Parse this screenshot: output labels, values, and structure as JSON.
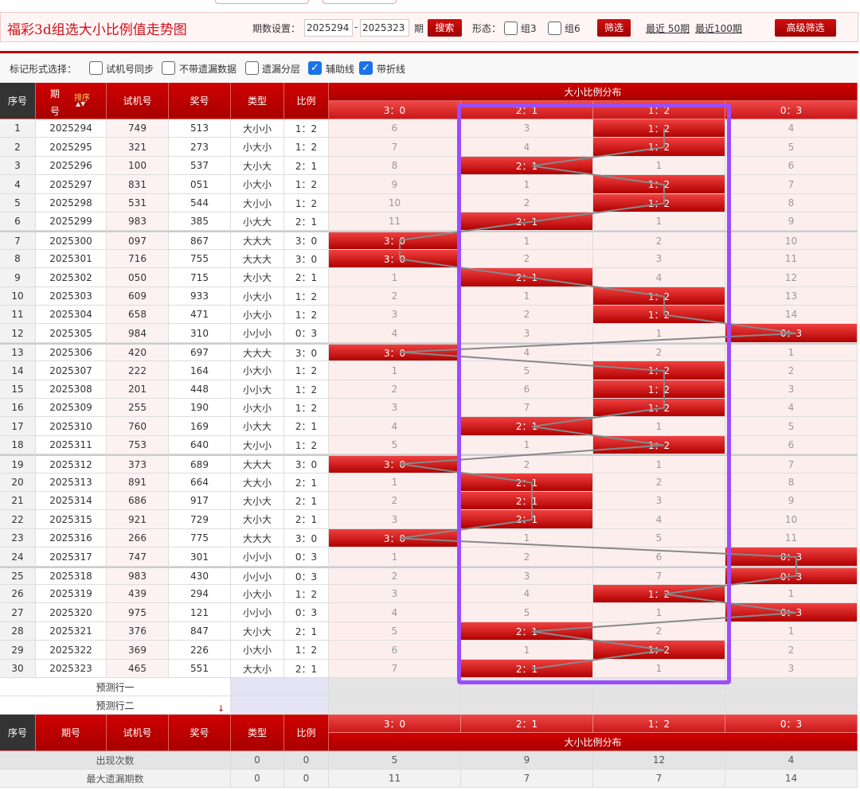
{
  "header": {
    "title": "福彩3d组选大小比例值走势图",
    "period_label": "期数设置：",
    "period_from": "2025294",
    "period_sep": "-",
    "period_to": "2025323",
    "period_unit": "期",
    "search": "搜索",
    "form_label": "形态：",
    "group3": "组3",
    "group6": "组6",
    "filter": "筛选",
    "recent50": "最近 50期",
    "recent100": "最近100期",
    "advanced": "高级筛选"
  },
  "options": {
    "label": "标记形式选择：",
    "items": [
      {
        "label": "试机号同步",
        "checked": false
      },
      {
        "label": "不带遗漏数据",
        "checked": false
      },
      {
        "label": "遗漏分层",
        "checked": false
      },
      {
        "label": "辅助线",
        "checked": true
      },
      {
        "label": "带折线",
        "checked": true
      }
    ]
  },
  "table": {
    "headers": {
      "seq": "序号",
      "issue": "期号",
      "issue_top": "期",
      "issue_bottom": "号",
      "sort": "排序",
      "test": "试机号",
      "prize": "奖号",
      "type": "类型",
      "ratio": "比例",
      "dist": "大小比例分布"
    },
    "dist_cols": [
      "3：0",
      "2：1",
      "1：2",
      "0：3"
    ],
    "rows": [
      [
        "1",
        "2025294",
        "749",
        "513",
        "大小小",
        "1：2",
        2,
        [
          "6",
          "3",
          "1：2",
          "4"
        ]
      ],
      [
        "2",
        "2025295",
        "321",
        "273",
        "小大小",
        "1：2",
        2,
        [
          "7",
          "4",
          "1：2",
          "5"
        ]
      ],
      [
        "3",
        "2025296",
        "100",
        "537",
        "大小大",
        "2：1",
        1,
        [
          "8",
          "2：1",
          "1",
          "6"
        ]
      ],
      [
        "4",
        "2025297",
        "831",
        "051",
        "小大小",
        "1：2",
        2,
        [
          "9",
          "1",
          "1：2",
          "7"
        ]
      ],
      [
        "5",
        "2025298",
        "531",
        "544",
        "大小小",
        "1：2",
        2,
        [
          "10",
          "2",
          "1：2",
          "8"
        ]
      ],
      [
        "6",
        "2025299",
        "983",
        "385",
        "小大大",
        "2：1",
        1,
        [
          "11",
          "2：1",
          "1",
          "9"
        ]
      ],
      [
        "7",
        "2025300",
        "097",
        "867",
        "大大大",
        "3：0",
        0,
        [
          "3：0",
          "1",
          "2",
          "10"
        ]
      ],
      [
        "8",
        "2025301",
        "716",
        "755",
        "大大大",
        "3：0",
        0,
        [
          "3：0",
          "2",
          "3",
          "11"
        ]
      ],
      [
        "9",
        "2025302",
        "050",
        "715",
        "大小大",
        "2：1",
        1,
        [
          "1",
          "2：1",
          "4",
          "12"
        ]
      ],
      [
        "10",
        "2025303",
        "609",
        "933",
        "小大小",
        "1：2",
        2,
        [
          "2",
          "1",
          "1：2",
          "13"
        ]
      ],
      [
        "11",
        "2025304",
        "658",
        "471",
        "小大小",
        "1：2",
        2,
        [
          "3",
          "2",
          "1：2",
          "14"
        ]
      ],
      [
        "12",
        "2025305",
        "984",
        "310",
        "小小小",
        "0：3",
        3,
        [
          "4",
          "3",
          "1",
          "0：3"
        ]
      ],
      [
        "13",
        "2025306",
        "420",
        "697",
        "大大大",
        "3：0",
        0,
        [
          "3：0",
          "4",
          "2",
          "1"
        ]
      ],
      [
        "14",
        "2025307",
        "222",
        "164",
        "小大小",
        "1：2",
        2,
        [
          "1",
          "5",
          "1：2",
          "2"
        ]
      ],
      [
        "15",
        "2025308",
        "201",
        "448",
        "小小大",
        "1：2",
        2,
        [
          "2",
          "6",
          "1：2",
          "3"
        ]
      ],
      [
        "16",
        "2025309",
        "255",
        "190",
        "小大小",
        "1：2",
        2,
        [
          "3",
          "7",
          "1：2",
          "4"
        ]
      ],
      [
        "17",
        "2025310",
        "760",
        "169",
        "小大大",
        "2：1",
        1,
        [
          "4",
          "2：1",
          "1",
          "5"
        ]
      ],
      [
        "18",
        "2025311",
        "753",
        "640",
        "大小小",
        "1：2",
        2,
        [
          "5",
          "1",
          "1：2",
          "6"
        ]
      ],
      [
        "19",
        "2025312",
        "373",
        "689",
        "大大大",
        "3：0",
        0,
        [
          "3：0",
          "2",
          "1",
          "7"
        ]
      ],
      [
        "20",
        "2025313",
        "891",
        "664",
        "大大小",
        "2：1",
        1,
        [
          "1",
          "2：1",
          "2",
          "8"
        ]
      ],
      [
        "21",
        "2025314",
        "686",
        "917",
        "大小大",
        "2：1",
        1,
        [
          "2",
          "2：1",
          "3",
          "9"
        ]
      ],
      [
        "22",
        "2025315",
        "921",
        "729",
        "大小大",
        "2：1",
        1,
        [
          "3",
          "2：1",
          "4",
          "10"
        ]
      ],
      [
        "23",
        "2025316",
        "266",
        "775",
        "大大大",
        "3：0",
        0,
        [
          "3：0",
          "1",
          "5",
          "11"
        ]
      ],
      [
        "24",
        "2025317",
        "747",
        "301",
        "小小小",
        "0：3",
        3,
        [
          "1",
          "2",
          "6",
          "0：3"
        ]
      ],
      [
        "25",
        "2025318",
        "983",
        "430",
        "小小小",
        "0：3",
        3,
        [
          "2",
          "3",
          "7",
          "0：3"
        ]
      ],
      [
        "26",
        "2025319",
        "439",
        "294",
        "小大小",
        "1：2",
        2,
        [
          "3",
          "4",
          "1：2",
          "1"
        ]
      ],
      [
        "27",
        "2025320",
        "975",
        "121",
        "小小小",
        "0：3",
        3,
        [
          "4",
          "5",
          "1",
          "0：3"
        ]
      ],
      [
        "28",
        "2025321",
        "376",
        "847",
        "大小大",
        "2：1",
        1,
        [
          "5",
          "2：1",
          "2",
          "1"
        ]
      ],
      [
        "29",
        "2025322",
        "369",
        "226",
        "小大小",
        "1：2",
        2,
        [
          "6",
          "1",
          "1：2",
          "2"
        ]
      ],
      [
        "30",
        "2025323",
        "465",
        "551",
        "大大小",
        "2：1",
        1,
        [
          "7",
          "2：1",
          "1",
          "3"
        ]
      ]
    ],
    "predict": [
      "预测行一",
      "预测行二"
    ],
    "stats": [
      {
        "label": "出现次数",
        "type": "0",
        "ratio": "0",
        "values": [
          "5",
          "9",
          "12",
          "4"
        ]
      },
      {
        "label": "最大遗漏期数",
        "type": "0",
        "ratio": "0",
        "values": [
          "11",
          "7",
          "7",
          "14"
        ]
      }
    ]
  },
  "colors": {
    "accent": "#c00000",
    "highlight": "#9b4dff",
    "line": "#888888"
  }
}
